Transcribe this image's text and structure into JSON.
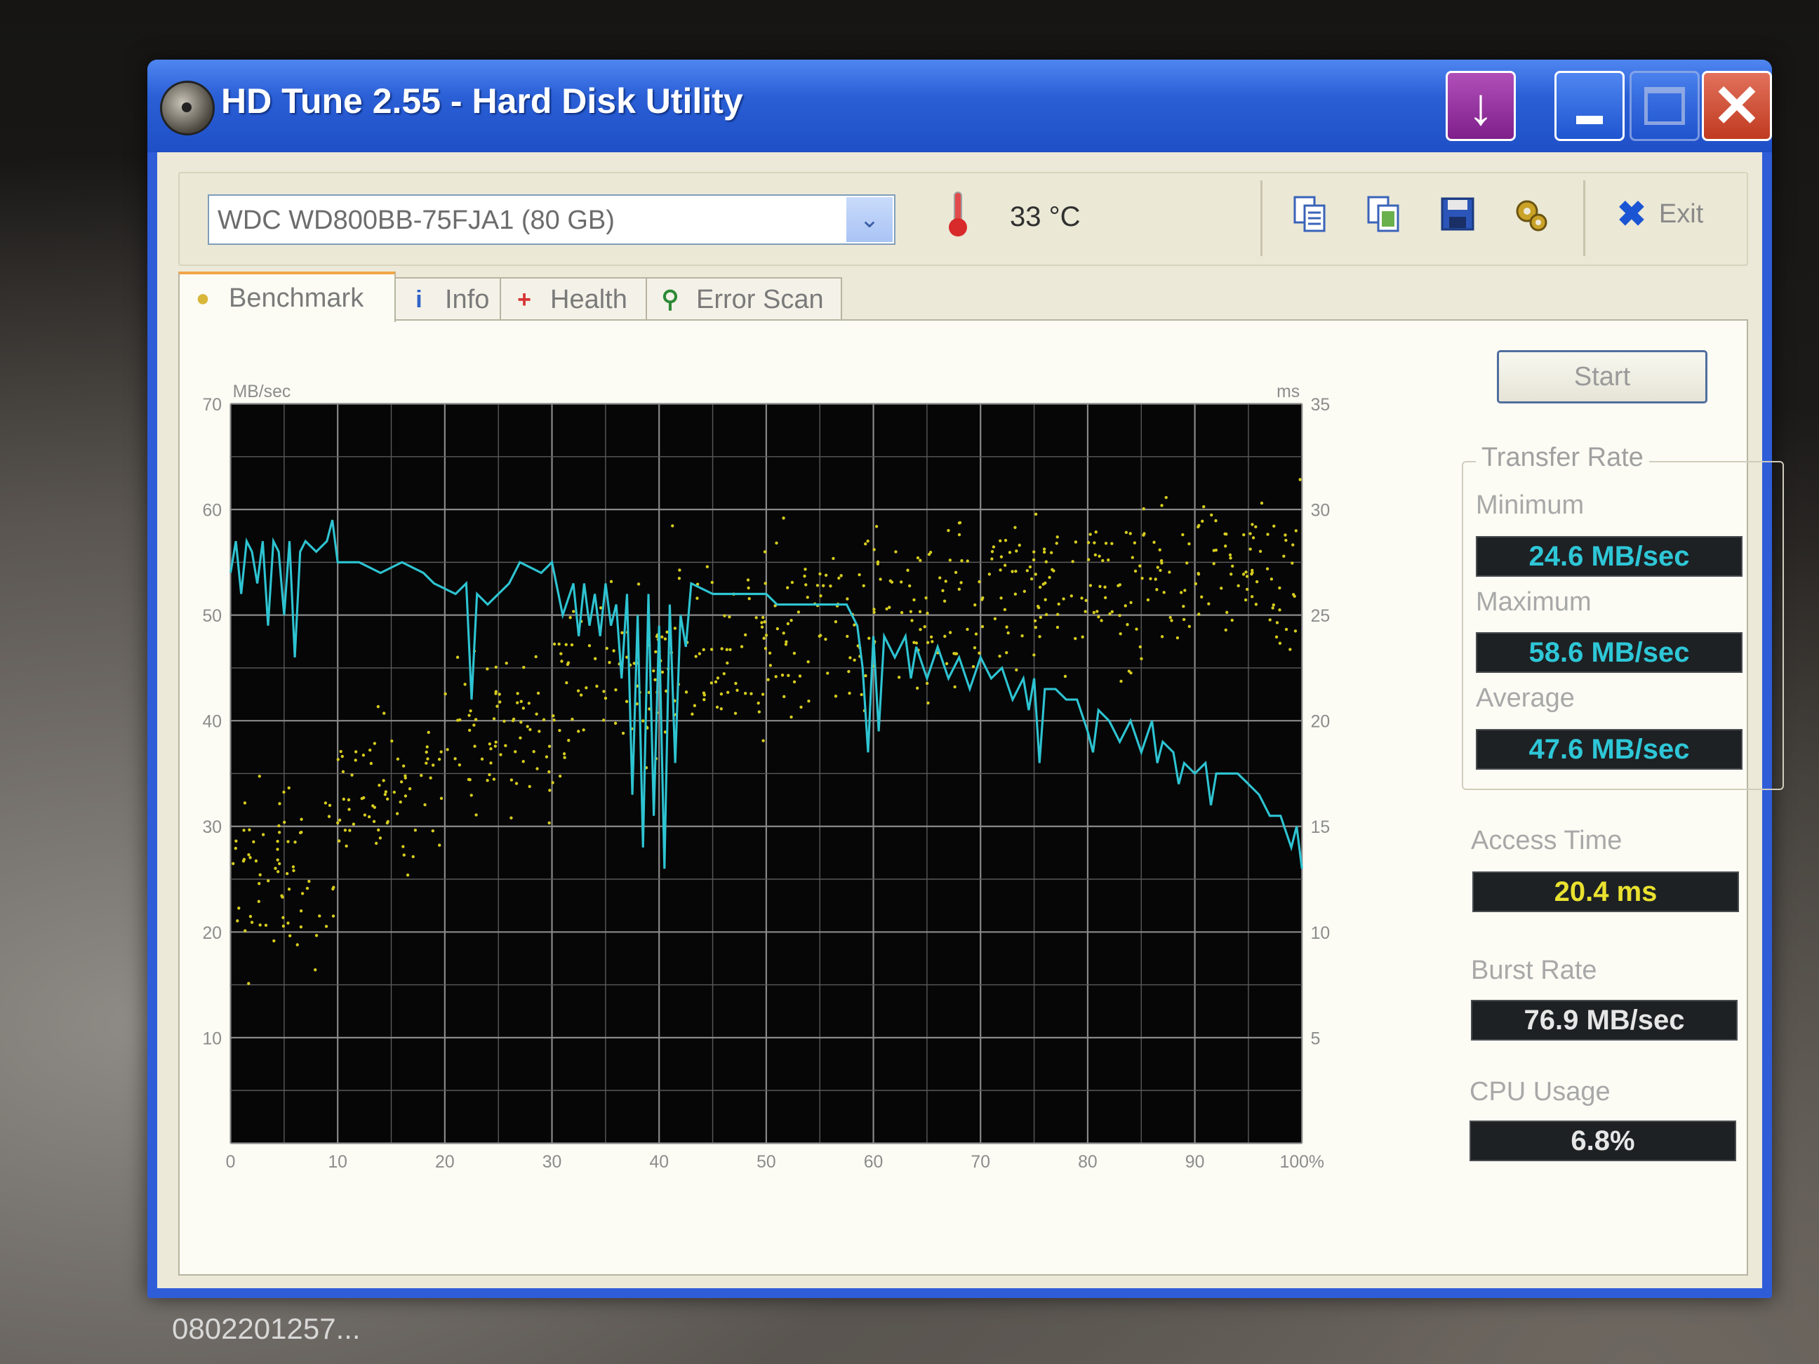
{
  "window": {
    "title": "HD Tune 2.55 - Hard Disk Utility"
  },
  "toolbar": {
    "drive": "WDC WD800BB-75FJA1 (80 GB)",
    "temperature": "33 °C",
    "exit_label": "Exit"
  },
  "tabs": [
    {
      "label": "Benchmark",
      "icon": "bulb-icon",
      "active": true
    },
    {
      "label": "Info",
      "icon": "info-icon",
      "active": false
    },
    {
      "label": "Health",
      "icon": "health-cross-icon",
      "active": false
    },
    {
      "label": "Error Scan",
      "icon": "magnifier-icon",
      "active": false
    }
  ],
  "benchmark": {
    "start_label": "Start",
    "transfer_rate_title": "Transfer Rate",
    "minimum_label": "Minimum",
    "minimum_value": "24.6 MB/sec",
    "maximum_label": "Maximum",
    "maximum_value": "58.6 MB/sec",
    "average_label": "Average",
    "average_value": "47.6 MB/sec",
    "access_time_label": "Access Time",
    "access_time_value": "20.4 ms",
    "burst_rate_label": "Burst Rate",
    "burst_rate_value": "76.9 MB/sec",
    "cpu_usage_label": "CPU Usage",
    "cpu_usage_value": "6.8%"
  },
  "chart_data": {
    "type": "line",
    "ylabel_left": "MB/sec",
    "ylabel_right": "ms",
    "y_left_ticks": [
      "10",
      "20",
      "30",
      "40",
      "50",
      "60",
      "70"
    ],
    "y_right_ticks": [
      "5",
      "10",
      "15",
      "20",
      "25",
      "30",
      "35"
    ],
    "x_ticks": [
      "0",
      "10",
      "20",
      "30",
      "40",
      "50",
      "60",
      "70",
      "80",
      "90",
      "100%"
    ],
    "ylim_left": [
      0,
      70
    ],
    "ylim_right": [
      0,
      35
    ],
    "xlim": [
      0,
      100
    ],
    "grid": true,
    "series": [
      {
        "kind": "transfer-rate",
        "axis": "left",
        "color": "#2ec4d2",
        "points": [
          [
            0,
            54
          ],
          [
            0.5,
            57
          ],
          [
            1,
            52
          ],
          [
            1.5,
            57
          ],
          [
            2,
            56
          ],
          [
            2.5,
            53
          ],
          [
            3,
            57
          ],
          [
            3.5,
            49
          ],
          [
            4,
            57
          ],
          [
            4.5,
            56
          ],
          [
            5,
            50
          ],
          [
            5.5,
            57
          ],
          [
            6,
            46
          ],
          [
            6.5,
            56
          ],
          [
            7,
            57
          ],
          [
            8,
            56
          ],
          [
            9,
            57
          ],
          [
            9.5,
            59
          ],
          [
            10,
            55
          ],
          [
            12,
            55
          ],
          [
            14,
            54
          ],
          [
            16,
            55
          ],
          [
            18,
            54
          ],
          [
            19,
            53
          ],
          [
            21,
            52
          ],
          [
            22,
            53
          ],
          [
            22.5,
            42
          ],
          [
            23,
            52
          ],
          [
            24,
            51
          ],
          [
            26,
            53
          ],
          [
            27,
            55
          ],
          [
            29,
            54
          ],
          [
            30,
            55
          ],
          [
            31,
            50
          ],
          [
            32,
            53
          ],
          [
            32.5,
            48
          ],
          [
            33,
            53
          ],
          [
            33.5,
            49
          ],
          [
            34,
            52
          ],
          [
            34.5,
            48
          ],
          [
            35,
            53
          ],
          [
            35.5,
            49
          ],
          [
            36,
            51
          ],
          [
            36.5,
            44
          ],
          [
            37,
            52
          ],
          [
            37.5,
            33
          ],
          [
            38,
            50
          ],
          [
            38.5,
            28
          ],
          [
            39,
            52
          ],
          [
            39.5,
            31
          ],
          [
            40,
            49
          ],
          [
            40.5,
            26
          ],
          [
            41,
            51
          ],
          [
            41.5,
            36
          ],
          [
            42,
            50
          ],
          [
            42.5,
            47
          ],
          [
            43,
            53
          ],
          [
            45,
            52
          ],
          [
            47,
            52
          ],
          [
            50,
            52
          ],
          [
            51,
            51
          ],
          [
            53,
            51
          ],
          [
            56,
            51
          ],
          [
            57.5,
            51
          ],
          [
            58.5,
            49
          ],
          [
            59,
            45
          ],
          [
            59.5,
            37
          ],
          [
            60,
            48
          ],
          [
            60.5,
            39
          ],
          [
            61,
            48
          ],
          [
            62,
            46
          ],
          [
            63,
            48
          ],
          [
            63.5,
            44
          ],
          [
            64,
            47
          ],
          [
            65,
            44
          ],
          [
            66,
            47
          ],
          [
            67,
            44
          ],
          [
            68,
            46
          ],
          [
            69,
            43
          ],
          [
            70,
            46
          ],
          [
            71,
            44
          ],
          [
            72,
            45
          ],
          [
            73,
            42
          ],
          [
            74,
            44
          ],
          [
            74.5,
            41
          ],
          [
            75,
            44
          ],
          [
            75.5,
            36
          ],
          [
            76,
            43
          ],
          [
            77,
            43
          ],
          [
            78,
            42
          ],
          [
            79,
            42
          ],
          [
            80,
            39
          ],
          [
            80.5,
            37
          ],
          [
            81,
            41
          ],
          [
            82,
            40
          ],
          [
            83,
            38
          ],
          [
            84,
            40
          ],
          [
            85,
            37
          ],
          [
            86,
            40
          ],
          [
            86.5,
            36
          ],
          [
            87,
            38
          ],
          [
            88,
            37
          ],
          [
            88.5,
            34
          ],
          [
            89,
            36
          ],
          [
            90,
            35
          ],
          [
            91,
            36
          ],
          [
            91.5,
            32
          ],
          [
            92,
            35
          ],
          [
            94,
            35
          ],
          [
            95,
            34
          ],
          [
            96,
            33
          ],
          [
            97,
            31
          ],
          [
            98,
            31
          ],
          [
            99,
            28
          ],
          [
            99.5,
            30
          ],
          [
            100,
            26
          ]
        ]
      },
      {
        "kind": "access-time",
        "axis": "right",
        "color": "#d6cc1e",
        "style": "scatter",
        "spread_ms": [
          {
            "x_range": [
              0,
              10
            ],
            "ms_range": [
              7,
              19
            ]
          },
          {
            "x_range": [
              10,
              20
            ],
            "ms_range": [
              12,
              22
            ]
          },
          {
            "x_range": [
              20,
              30
            ],
            "ms_range": [
              14,
              25
            ]
          },
          {
            "x_range": [
              30,
              40
            ],
            "ms_range": [
              16,
              28
            ]
          },
          {
            "x_range": [
              40,
              50
            ],
            "ms_range": [
              17,
              31
            ]
          },
          {
            "x_range": [
              50,
              60
            ],
            "ms_range": [
              18,
              31
            ]
          },
          {
            "x_range": [
              60,
              70
            ],
            "ms_range": [
              19,
              32
            ]
          },
          {
            "x_range": [
              70,
              80
            ],
            "ms_range": [
              20,
              32
            ]
          },
          {
            "x_range": [
              80,
              90
            ],
            "ms_range": [
              21,
              32
            ]
          },
          {
            "x_range": [
              90,
              100
            ],
            "ms_range": [
              22,
              32
            ]
          }
        ]
      }
    ]
  },
  "taskbar": {
    "text": "0802201257..."
  }
}
